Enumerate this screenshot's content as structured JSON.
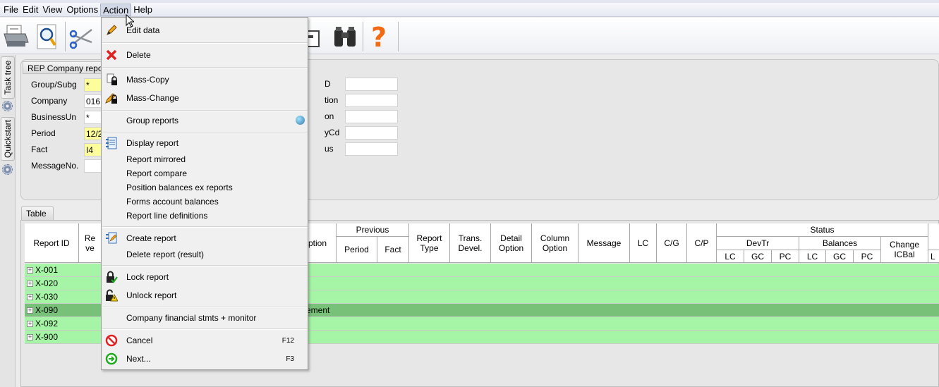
{
  "menubar": [
    "File",
    "Edit",
    "View",
    "Options",
    "Action",
    "Help"
  ],
  "toolbar": {
    "icons": [
      "printer-icon",
      "print-preview-icon",
      "scissors-icon",
      "clipboard-icon",
      "binoculars-icon",
      "help-icon"
    ]
  },
  "vtabs": {
    "task_tree": "Task tree",
    "quickstart": "Quickstart"
  },
  "form": {
    "title": "REP Company repo",
    "fields": [
      {
        "label": "Group/Subg",
        "value": "*",
        "required": true
      },
      {
        "label": "Company",
        "value": "016",
        "required": false
      },
      {
        "label": "BusinessUn",
        "value": "*",
        "required": false
      },
      {
        "label": "Period",
        "value": "12/2",
        "required": true
      },
      {
        "label": "Fact",
        "value": "I4",
        "required": true
      },
      {
        "label": "MessageNo.",
        "value": "",
        "required": false
      }
    ],
    "right_fields": [
      "D",
      "tion",
      "on",
      "yCd",
      "us"
    ]
  },
  "table": {
    "tab_label": "Table",
    "headers": {
      "report_id": "Report ID",
      "report_ve": "Re ve",
      "description_partial": "ption",
      "previous": "Previous",
      "period": "Period",
      "fact": "Fact",
      "report_type": "Report Type",
      "trans_devel": "Trans. Devel.",
      "detail_option": "Detail Option",
      "column_option": "Column Option",
      "message": "Message",
      "lc": "LC",
      "cg": "C/G",
      "cp": "C/P",
      "status": "Status",
      "devtr": "DevTr",
      "balances": "Balances",
      "change_icbal": "Change ICBal",
      "devtr_lc": "LC",
      "devtr_gc": "GC",
      "devtr_pc": "PC",
      "bal_lc": "LC",
      "bal_gc": "GC",
      "bal_pc": "PC",
      "trailing": "L"
    },
    "rows": [
      {
        "id": "X-001",
        "desc": "",
        "selected": false
      },
      {
        "id": "X-020",
        "desc": "",
        "selected": false
      },
      {
        "id": "X-030",
        "desc": "",
        "selected": false
      },
      {
        "id": "X-090",
        "desc": "ement",
        "selected": true
      },
      {
        "id": "X-092",
        "desc": "",
        "selected": false
      },
      {
        "id": "X-900",
        "desc": "",
        "selected": false
      }
    ]
  },
  "action_menu": {
    "items": [
      {
        "label": "Edit data",
        "icon": "pencil-icon"
      },
      {
        "label": "Delete",
        "icon": "red-x-icon"
      },
      {
        "label": "Mass-Copy",
        "icon": "copy-lock-icon"
      },
      {
        "label": "Mass-Change",
        "icon": "pencil-lock-icon"
      },
      {
        "label": "Group reports",
        "icon": "globe-icon"
      },
      {
        "label": "Display report",
        "icon": "notebook-icon"
      },
      {
        "label": "Report mirrored",
        "icon": ""
      },
      {
        "label": "Report compare",
        "icon": ""
      },
      {
        "label": "Position balances ex reports",
        "icon": ""
      },
      {
        "label": "Forms account balances",
        "icon": ""
      },
      {
        "label": "Report line definitions",
        "icon": ""
      },
      {
        "label": "Create report",
        "icon": "create-report-icon"
      },
      {
        "label": "Delete report (result)",
        "icon": ""
      },
      {
        "label": "Lock report",
        "icon": "lock-check-icon"
      },
      {
        "label": "Unlock report",
        "icon": "unlock-warning-icon"
      },
      {
        "label": "Company financial stmts + monitor",
        "icon": ""
      },
      {
        "label": "Cancel",
        "icon": "cancel-icon",
        "shortcut": "F12"
      },
      {
        "label": "Next...",
        "icon": "next-arrow-icon",
        "shortcut": "F3"
      }
    ]
  },
  "colors": {
    "row_green": "#a6f5a6",
    "row_selected": "#78c178",
    "required_yellow": "#fdfd9c"
  }
}
